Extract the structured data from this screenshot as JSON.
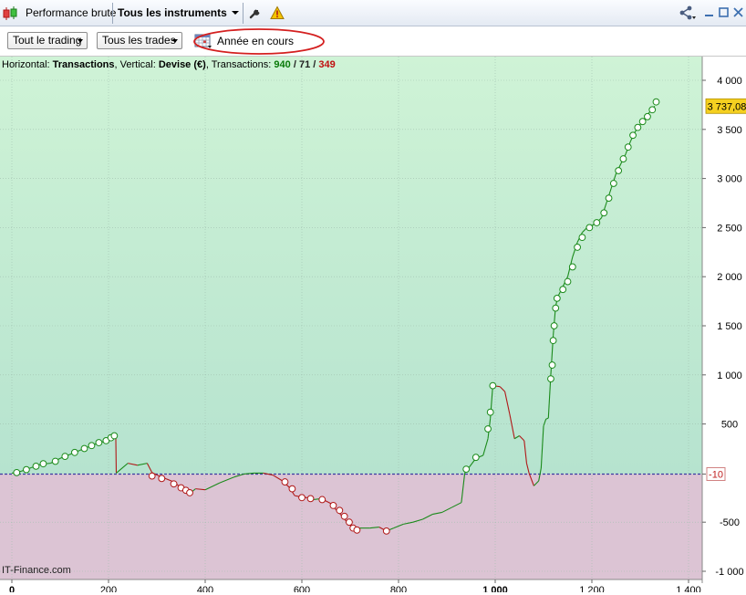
{
  "toolbar": {
    "tab_performance": "Performance brute",
    "tab_instruments": "Tous les instruments"
  },
  "filters": {
    "trading": "Tout le trading",
    "trades": "Tous les trades",
    "period": "Année en cours"
  },
  "info": {
    "horizontal_label": "Horizontal:",
    "horizontal_value": "Transactions",
    "vertical_label": "Vertical:",
    "vertical_value": "Devise (€)",
    "transactions_label": "Transactions:",
    "total": "940",
    "neutral": "71",
    "losing": "349",
    "slash": "/"
  },
  "watermark": "IT-Finance.com",
  "colors": {
    "profit_bg": "#c9efd2",
    "loss_bg": "#dcc4d4",
    "profit_line": "#1a8a1a",
    "loss_line": "#b01818",
    "zero_line": "#3a3aa0",
    "last_value_bg": "#f5d020"
  },
  "chart_data": {
    "type": "line",
    "x_ticks": [
      "0",
      "200",
      "400",
      "600",
      "800",
      "1 000",
      "1 200",
      "1 400"
    ],
    "y_ticks": [
      "4 000",
      "3 500",
      "3 000",
      "2 500",
      "2 000",
      "1 500",
      "1 000",
      "500",
      "-10",
      "-500",
      "-1 000"
    ],
    "xlim": [
      0,
      1430
    ],
    "ylim": [
      -1000,
      4000
    ],
    "zero_marker": "-10",
    "last_value": "3 737,08",
    "last_value_num": 3737.08,
    "series": [
      {
        "points": [
          [
            0,
            0
          ],
          [
            10,
            5
          ],
          [
            20,
            20
          ],
          [
            40,
            55
          ],
          [
            60,
            90
          ],
          [
            80,
            100
          ],
          [
            100,
            150
          ],
          [
            120,
            190
          ],
          [
            140,
            230
          ],
          [
            160,
            270
          ],
          [
            175,
            300
          ],
          [
            190,
            320
          ],
          [
            200,
            350
          ],
          [
            210,
            370
          ],
          [
            215,
            380
          ],
          [
            216,
            0
          ],
          [
            240,
            100
          ],
          [
            260,
            80
          ],
          [
            280,
            100
          ],
          [
            290,
            5
          ],
          [
            300,
            -20
          ],
          [
            320,
            -60
          ],
          [
            330,
            -80
          ],
          [
            340,
            -110
          ],
          [
            350,
            -150
          ],
          [
            360,
            -170
          ],
          [
            370,
            -200
          ],
          [
            380,
            -160
          ],
          [
            400,
            -170
          ],
          [
            430,
            -100
          ],
          [
            460,
            -40
          ],
          [
            480,
            -10
          ],
          [
            500,
            0
          ],
          [
            520,
            0
          ],
          [
            540,
            -20
          ],
          [
            560,
            -80
          ],
          [
            575,
            -150
          ],
          [
            585,
            -230
          ],
          [
            595,
            -240
          ],
          [
            610,
            -250
          ],
          [
            625,
            -270
          ],
          [
            640,
            -260
          ],
          [
            660,
            -310
          ],
          [
            670,
            -370
          ],
          [
            680,
            -420
          ],
          [
            690,
            -480
          ],
          [
            700,
            -530
          ],
          [
            710,
            -570
          ],
          [
            720,
            -560
          ],
          [
            740,
            -560
          ],
          [
            760,
            -550
          ],
          [
            775,
            -590
          ],
          [
            790,
            -560
          ],
          [
            810,
            -520
          ],
          [
            830,
            -500
          ],
          [
            850,
            -470
          ],
          [
            870,
            -420
          ],
          [
            890,
            -400
          ],
          [
            910,
            -350
          ],
          [
            930,
            -300
          ],
          [
            937,
            0
          ],
          [
            960,
            150
          ],
          [
            975,
            180
          ],
          [
            985,
            350
          ],
          [
            990,
            560
          ],
          [
            995,
            890
          ],
          [
            1010,
            880
          ],
          [
            1020,
            830
          ],
          [
            1030,
            600
          ],
          [
            1040,
            350
          ],
          [
            1050,
            380
          ],
          [
            1060,
            330
          ],
          [
            1065,
            100
          ],
          [
            1070,
            0
          ],
          [
            1080,
            -130
          ],
          [
            1090,
            -80
          ],
          [
            1095,
            50
          ],
          [
            1100,
            480
          ],
          [
            1105,
            550
          ],
          [
            1110,
            560
          ],
          [
            1115,
            1000
          ],
          [
            1120,
            1400
          ],
          [
            1125,
            1700
          ],
          [
            1130,
            1800
          ],
          [
            1140,
            1900
          ],
          [
            1150,
            2000
          ],
          [
            1160,
            2200
          ],
          [
            1170,
            2350
          ],
          [
            1180,
            2450
          ],
          [
            1190,
            2500
          ],
          [
            1200,
            2520
          ],
          [
            1210,
            2550
          ],
          [
            1220,
            2600
          ],
          [
            1230,
            2750
          ],
          [
            1240,
            2900
          ],
          [
            1250,
            3050
          ],
          [
            1260,
            3150
          ],
          [
            1270,
            3250
          ],
          [
            1280,
            3380
          ],
          [
            1290,
            3480
          ],
          [
            1300,
            3550
          ],
          [
            1310,
            3620
          ],
          [
            1320,
            3680
          ],
          [
            1330,
            3737
          ]
        ],
        "winning_markers": [
          [
            10,
            5
          ],
          [
            30,
            35
          ],
          [
            50,
            70
          ],
          [
            65,
            95
          ],
          [
            90,
            120
          ],
          [
            110,
            170
          ],
          [
            130,
            210
          ],
          [
            150,
            250
          ],
          [
            165,
            280
          ],
          [
            180,
            310
          ],
          [
            195,
            330
          ],
          [
            205,
            360
          ],
          [
            212,
            380
          ],
          [
            940,
            40
          ],
          [
            960,
            160
          ],
          [
            985,
            450
          ],
          [
            990,
            620
          ],
          [
            995,
            890
          ],
          [
            1115,
            960
          ],
          [
            1118,
            1100
          ],
          [
            1120,
            1350
          ],
          [
            1122,
            1500
          ],
          [
            1125,
            1680
          ],
          [
            1128,
            1780
          ],
          [
            1140,
            1870
          ],
          [
            1150,
            1950
          ],
          [
            1160,
            2100
          ],
          [
            1170,
            2300
          ],
          [
            1180,
            2400
          ],
          [
            1195,
            2500
          ],
          [
            1210,
            2550
          ],
          [
            1225,
            2650
          ],
          [
            1235,
            2800
          ],
          [
            1245,
            2950
          ],
          [
            1255,
            3080
          ],
          [
            1265,
            3200
          ],
          [
            1275,
            3320
          ],
          [
            1285,
            3440
          ],
          [
            1295,
            3520
          ],
          [
            1305,
            3580
          ],
          [
            1315,
            3630
          ],
          [
            1325,
            3700
          ],
          [
            1333,
            3780
          ]
        ],
        "losing_markers": [
          [
            290,
            -30
          ],
          [
            310,
            -55
          ],
          [
            335,
            -110
          ],
          [
            350,
            -150
          ],
          [
            360,
            -175
          ],
          [
            368,
            -200
          ],
          [
            565,
            -90
          ],
          [
            580,
            -160
          ],
          [
            600,
            -250
          ],
          [
            618,
            -260
          ],
          [
            642,
            -270
          ],
          [
            665,
            -330
          ],
          [
            678,
            -380
          ],
          [
            688,
            -440
          ],
          [
            698,
            -500
          ],
          [
            706,
            -560
          ],
          [
            714,
            -580
          ],
          [
            775,
            -590
          ]
        ]
      }
    ]
  }
}
